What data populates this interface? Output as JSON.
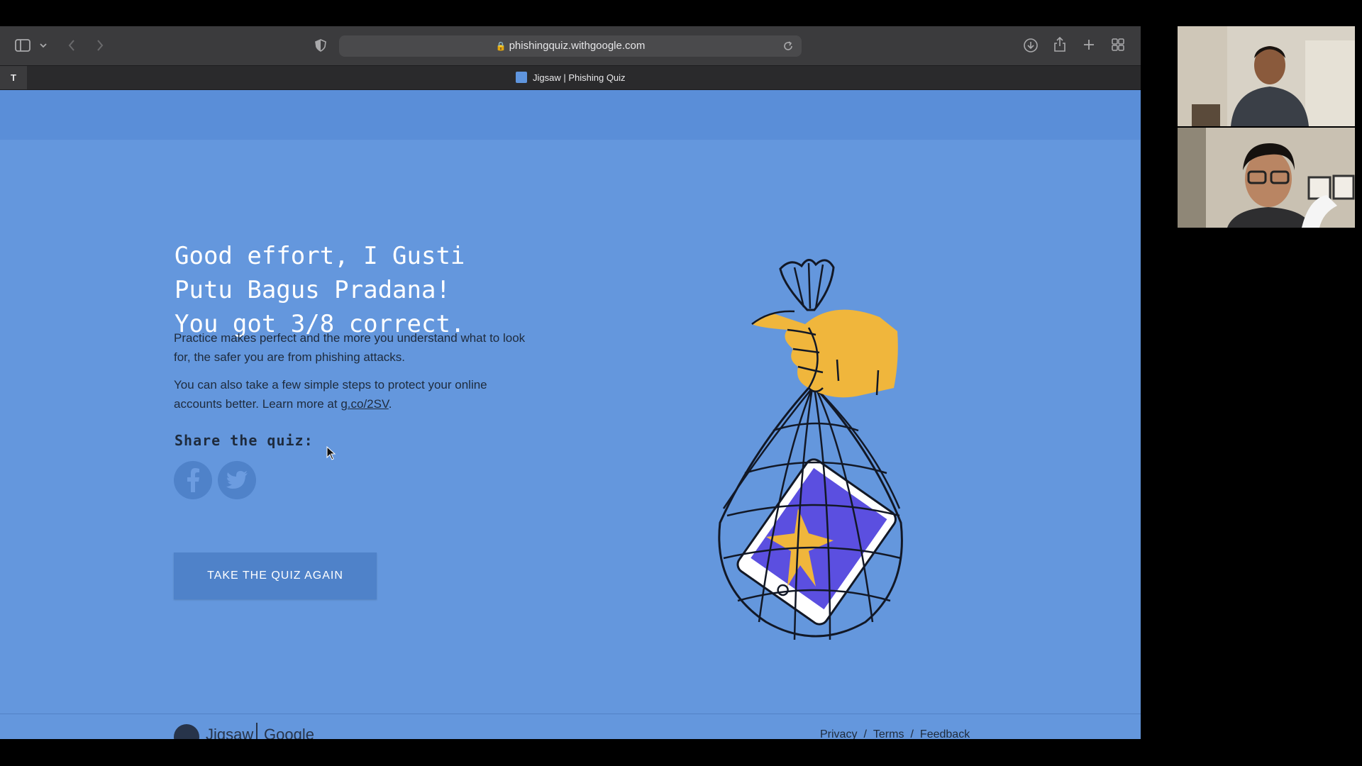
{
  "browser": {
    "url": "phishingquiz.withgoogle.com",
    "tab_title": "Jigsaw | Phishing Quiz",
    "tab_toggle_label": "T"
  },
  "result": {
    "headline": "Good effort, I Gusti\nPutu Bagus Pradana!\nYou got 3/8 correct.",
    "para1": "Practice makes perfect and the more you understand what to look for, the safer you are from phishing attacks.",
    "para2_prefix": "You can also take a few simple steps to protect your online accounts better. Learn more at ",
    "para2_link": "g.co/2SV",
    "para2_suffix": ".",
    "share_label": "Share the quiz:",
    "cta_label": "TAKE THE QUIZ AGAIN"
  },
  "footer": {
    "brand_jigsaw": "Jigsaw",
    "brand_google": "Google",
    "links": [
      "Privacy",
      "Terms",
      "Feedback"
    ],
    "separator": "/"
  },
  "colors": {
    "page_bg": "#6497dd",
    "button_bg": "#4f82c9",
    "illustration_hand": "#f0b63c",
    "illustration_phone": "#5b4fe0"
  }
}
